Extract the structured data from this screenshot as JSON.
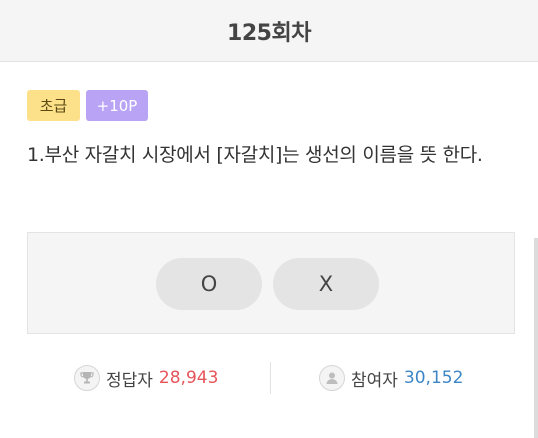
{
  "header": {
    "title": "125회차"
  },
  "quiz": {
    "level_badge": "초급",
    "point_badge": "+10P",
    "question": "1.부산 자갈치 시장에서 [자갈치]는 생선의 이름을 뜻 한다."
  },
  "answers": {
    "o_label": "O",
    "x_label": "X"
  },
  "stats": {
    "correct_label": "정답자",
    "correct_count": "28,943",
    "participants_label": "참여자",
    "participants_count": "30,152"
  },
  "colors": {
    "level_badge_bg": "#fde08a",
    "point_badge_bg": "#b8a3f4",
    "correct_count": "#e5555a",
    "participants_count": "#3d86c6"
  },
  "icons": {
    "correct": "trophy-icon",
    "participants": "user-icon"
  }
}
